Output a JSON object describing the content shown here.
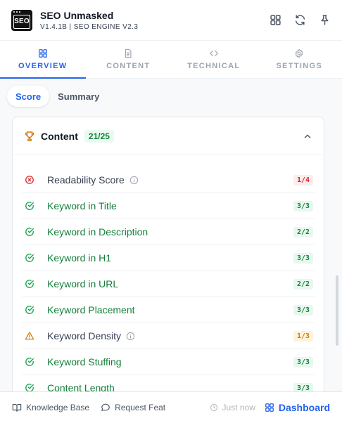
{
  "app": {
    "title": "SEO Unmasked",
    "subtitle": "V1.4.1B | SEO ENGINE V2.3",
    "logo_text": "SEO"
  },
  "header_icons": [
    "grid-icon",
    "refresh-icon",
    "pin-icon"
  ],
  "tabs": [
    {
      "label": "OVERVIEW",
      "icon": "grid-icon",
      "active": true
    },
    {
      "label": "CONTENT",
      "icon": "document-icon",
      "active": false
    },
    {
      "label": "TECHNICAL",
      "icon": "code-icon",
      "active": false
    },
    {
      "label": "SETTINGS",
      "icon": "gear-icon",
      "active": false
    }
  ],
  "subtabs": [
    {
      "label": "Score",
      "active": true
    },
    {
      "label": "Summary",
      "active": false
    }
  ],
  "section": {
    "title": "Content",
    "score": "21/25",
    "icon": "trophy-icon",
    "expanded": true
  },
  "checks": [
    {
      "label": "Readability Score",
      "score": "1/4",
      "status": "fail",
      "info": true
    },
    {
      "label": "Keyword in Title",
      "score": "3/3",
      "status": "pass",
      "info": false
    },
    {
      "label": "Keyword in Description",
      "score": "2/2",
      "status": "pass",
      "info": false
    },
    {
      "label": "Keyword in H1",
      "score": "3/3",
      "status": "pass",
      "info": false
    },
    {
      "label": "Keyword in URL",
      "score": "2/2",
      "status": "pass",
      "info": false
    },
    {
      "label": "Keyword Placement",
      "score": "3/3",
      "status": "pass",
      "info": false
    },
    {
      "label": "Keyword Density",
      "score": "1/3",
      "status": "warn",
      "info": true
    },
    {
      "label": "Keyword Stuffing",
      "score": "3/3",
      "status": "pass",
      "info": false
    },
    {
      "label": "Content Length",
      "score": "3/3",
      "status": "pass",
      "info": false
    }
  ],
  "footer": {
    "knowledge_base": "Knowledge Base",
    "request_feature": "Request Feat",
    "timestamp": "Just now",
    "dashboard": "Dashboard"
  },
  "colors": {
    "accent": "#2563eb",
    "pass": "#15803d",
    "fail": "#dc2626",
    "warn": "#d97706",
    "trophy": "#d97706"
  }
}
